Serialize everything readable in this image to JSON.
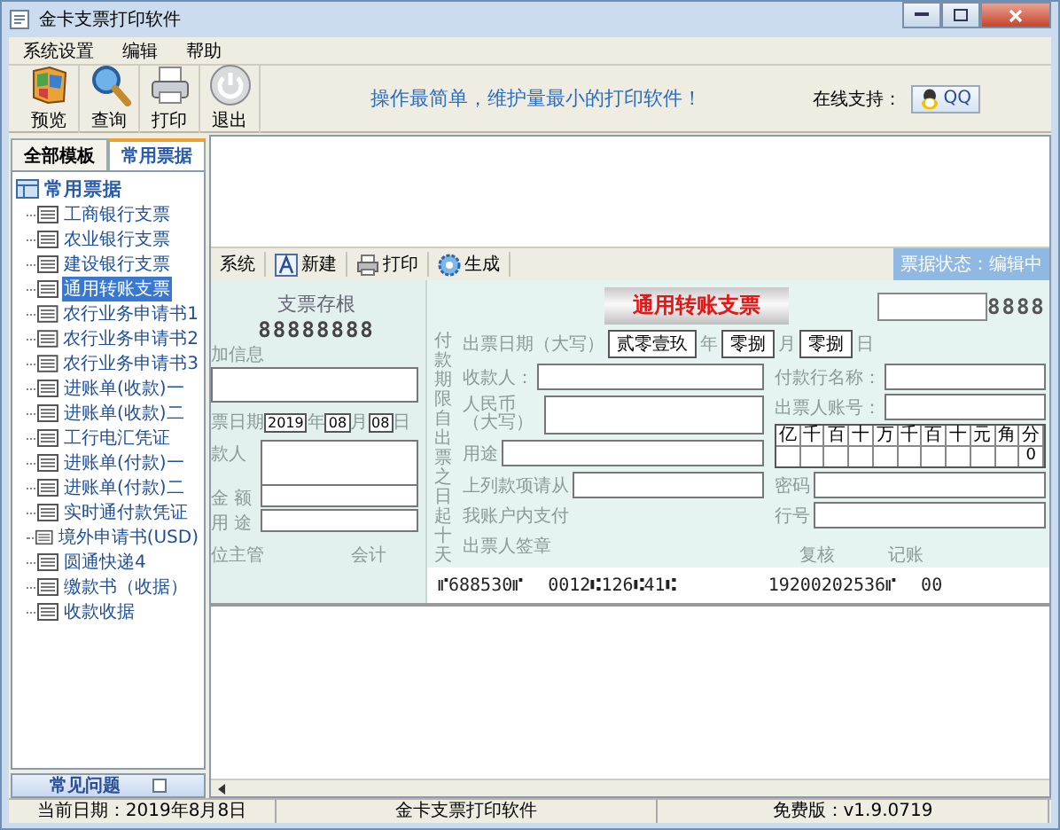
{
  "window": {
    "title": "金卡支票打印软件"
  },
  "menu": [
    "系统设置",
    "编辑",
    "帮助"
  ],
  "toolbar": [
    {
      "label": "预览",
      "kind": "preview"
    },
    {
      "label": "查询",
      "kind": "search"
    },
    {
      "label": "打印",
      "kind": "print"
    },
    {
      "label": "退出",
      "kind": "exit"
    }
  ],
  "slogan": "操作最简单，维护量最小的打印软件！",
  "support": {
    "label": "在线支持：",
    "button": "QQ"
  },
  "sidebar": {
    "tabs": [
      {
        "label": "全部模板",
        "selected": false
      },
      {
        "label": "常用票据",
        "selected": true
      }
    ],
    "tree": {
      "label": "常用票据",
      "children": [
        {
          "label": "工商银行支票",
          "selected": false
        },
        {
          "label": "农业银行支票",
          "selected": false
        },
        {
          "label": "建设银行支票",
          "selected": false
        },
        {
          "label": "通用转账支票",
          "selected": true
        },
        {
          "label": "农行业务申请书1",
          "selected": false
        },
        {
          "label": "农行业务申请书2",
          "selected": false
        },
        {
          "label": "农行业务申请书3",
          "selected": false
        },
        {
          "label": "进账单(收款)一",
          "selected": false
        },
        {
          "label": "进账单(收款)二",
          "selected": false
        },
        {
          "label": "工行电汇凭证",
          "selected": false
        },
        {
          "label": "进账单(付款)一",
          "selected": false
        },
        {
          "label": "进账单(付款)二",
          "selected": false
        },
        {
          "label": "实时通付款凭证",
          "selected": false
        },
        {
          "label": "境外申请书(USD)",
          "selected": false
        },
        {
          "label": "圆通快递4",
          "selected": false
        },
        {
          "label": "缴款书（收据）",
          "selected": false
        },
        {
          "label": "收款收据",
          "selected": false
        }
      ]
    },
    "footer": "常见问题"
  },
  "subtoolbar": {
    "items": [
      {
        "label": "系统",
        "kind": "text"
      },
      {
        "label": "新建",
        "kind": "new"
      },
      {
        "label": "打印",
        "kind": "print"
      },
      {
        "label": "生成",
        "kind": "generate"
      }
    ],
    "status": "票据状态：编辑中"
  },
  "stub": {
    "title": "支票存根",
    "number": "88888888",
    "info_label": "加信息",
    "date_label": "票日期",
    "year": "2019",
    "year_unit": "年",
    "month": "08",
    "month_unit": "月",
    "day": "08",
    "day_unit": "日",
    "rows": [
      "款人",
      "金 额",
      "用 途"
    ],
    "signatures": [
      "位主管",
      "会计"
    ]
  },
  "cheque": {
    "title": "通用转账支票",
    "number": "8888",
    "term": "付款期限自出票之日起十天",
    "date_label": "出票日期（大写）",
    "year": "贰零壹玖",
    "year_unit": "年",
    "month": "零捌",
    "month_unit": "月",
    "day": "零捌",
    "day_unit": "日",
    "payee_label": "收款人：",
    "amount_label": "人民币（大写）",
    "purpose_label": "用途",
    "from_label": "上列款项请从",
    "from_label2": "我账户内支付",
    "signer_label": "出票人签章",
    "bank_label": "付款行名称：",
    "account_label": "出票人账号：",
    "digits": [
      "亿",
      "千",
      "百",
      "十",
      "万",
      "千",
      "百",
      "十",
      "元",
      "角",
      "分"
    ],
    "amount_value": "0",
    "password_label": "密码",
    "bankno_label": "行号",
    "review_label": "复核",
    "book_label": "记账",
    "micr": [
      "⑈688530⑈",
      "0012⑆126⑆41⑆",
      "19200202536⑈",
      "00"
    ]
  },
  "status_bar": [
    "当前日期：2019年8月8日",
    "金卡支票打印软件",
    "免费版：v1.9.0719"
  ]
}
